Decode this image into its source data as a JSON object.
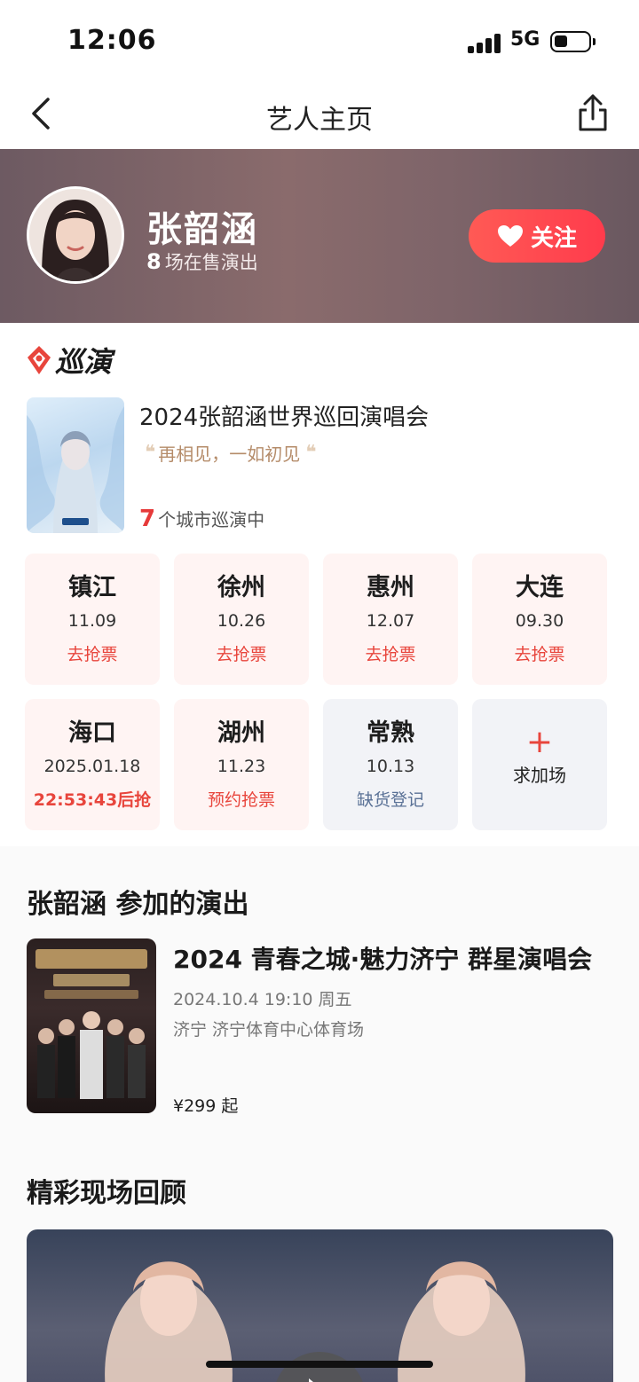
{
  "status_bar": {
    "time": "12:06",
    "network": "5G"
  },
  "nav": {
    "title": "艺人主页"
  },
  "artist": {
    "name": "张韶涵",
    "show_count": "8",
    "show_count_suffix": "场在售演出",
    "follow_label": "关注"
  },
  "tour": {
    "section_label": "巡演",
    "title": "2024张韶涵世界巡回演唱会",
    "quote": "再相见，一如初见",
    "city_count": "7",
    "city_count_suffix": "个城市巡演中",
    "cities": [
      {
        "name": "镇江",
        "date": "11.09",
        "action": "去抢票"
      },
      {
        "name": "徐州",
        "date": "10.26",
        "action": "去抢票"
      },
      {
        "name": "惠州",
        "date": "12.07",
        "action": "去抢票"
      },
      {
        "name": "大连",
        "date": "09.30",
        "action": "去抢票"
      },
      {
        "name": "海口",
        "date": "2025.01.18",
        "action": "22:53:43后抢"
      },
      {
        "name": "湖州",
        "date": "11.23",
        "action": "预约抢票"
      },
      {
        "name": "常熟",
        "date": "10.13",
        "action": "缺货登记"
      }
    ],
    "add_show_label": "求加场"
  },
  "performances": {
    "section_title": "张韶涵 参加的演出",
    "items": [
      {
        "title": "2024 青春之城·魅力济宁 群星演唱会",
        "time": "2024.10.4 19:10 周五",
        "venue": "济宁 济宁体育中心体育场",
        "price": "¥299 起"
      }
    ]
  },
  "highlights": {
    "section_title": "精彩现场回顾"
  },
  "colors": {
    "accent": "#e8453c",
    "follow_gradient_start": "#ff5a55",
    "follow_gradient_end": "#ff3b4c",
    "hero_bg": "#7e6469"
  }
}
